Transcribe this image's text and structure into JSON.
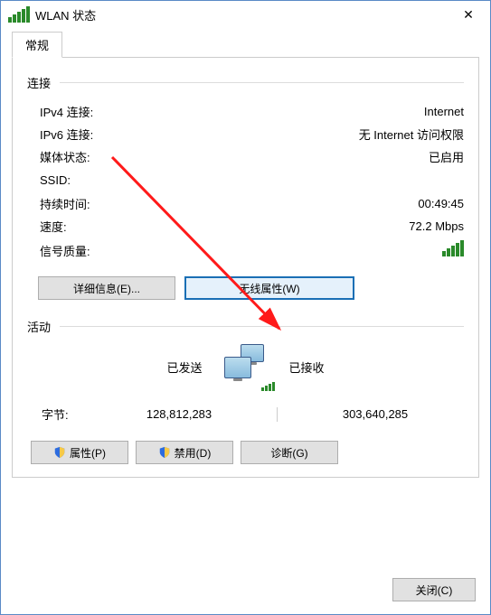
{
  "window": {
    "title": "WLAN 状态",
    "close": "✕"
  },
  "tabs": {
    "general": "常规"
  },
  "connection": {
    "section": "连接",
    "ipv4_label": "IPv4 连接:",
    "ipv4_value": "Internet",
    "ipv6_label": "IPv6 连接:",
    "ipv6_value": "无 Internet 访问权限",
    "media_label": "媒体状态:",
    "media_value": "已启用",
    "ssid_label": "SSID:",
    "ssid_value": "",
    "duration_label": "持续时间:",
    "duration_value": "00:49:45",
    "speed_label": "速度:",
    "speed_value": "72.2 Mbps",
    "signal_label": "信号质量:"
  },
  "buttons": {
    "details": "详细信息(E)...",
    "wireless": "无线属性(W)",
    "properties": "属性(P)",
    "disable": "禁用(D)",
    "diagnose": "诊断(G)",
    "close": "关闭(C)"
  },
  "activity": {
    "section": "活动",
    "sent": "已发送",
    "received": "已接收",
    "bytes_label": "字节:",
    "bytes_sent": "128,812,283",
    "bytes_received": "303,640,285"
  }
}
